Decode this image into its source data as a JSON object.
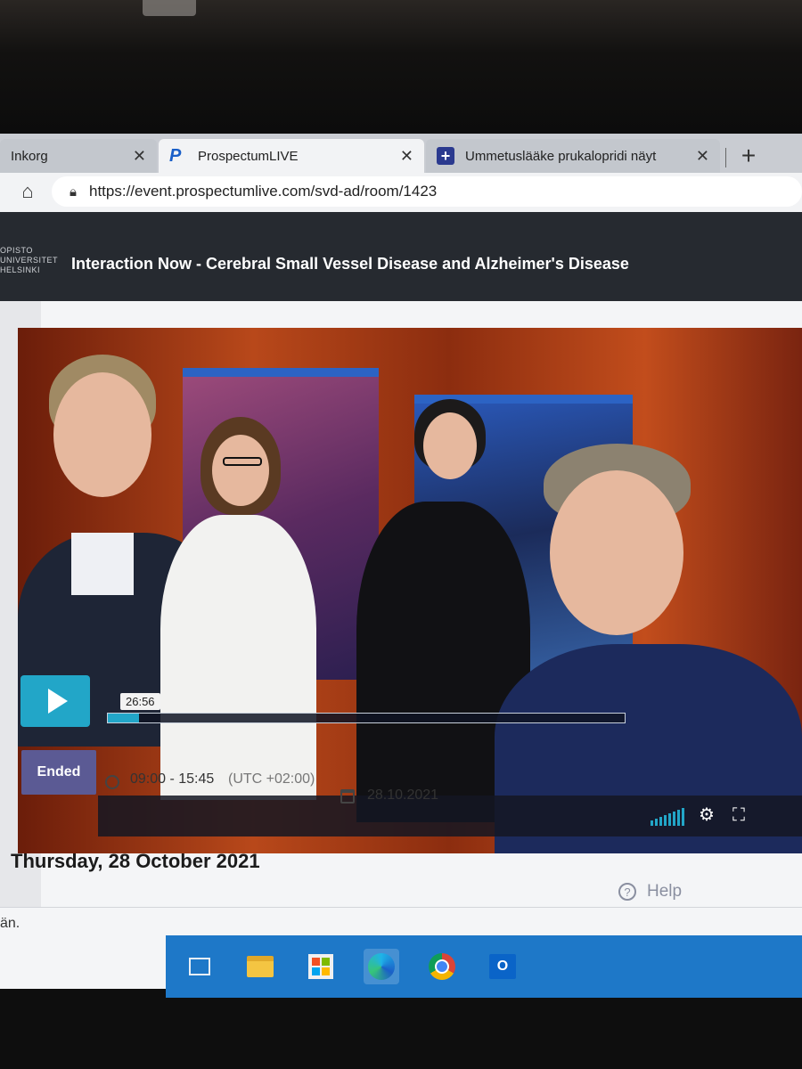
{
  "browser": {
    "tabs": [
      {
        "label": "Inkorg"
      },
      {
        "label": "ProspectumLIVE"
      },
      {
        "label": "Ummetuslääke prukalopridi näyt"
      }
    ],
    "close_glyph": "✕",
    "new_tab_glyph": "+",
    "url": "https://event.prospectumlive.com/svd-ad/room/1423"
  },
  "header": {
    "logo_lines": [
      "OPISTO",
      "UNIVERSITET",
      "HELSINKI"
    ],
    "title": "Interaction Now - Cerebral Small Vessel Disease and Alzheimer's Disease"
  },
  "player": {
    "time_tooltip": "26:56",
    "progress_fraction": 0.06,
    "state_icon": "play-icon"
  },
  "event": {
    "status_badge": "Ended",
    "time_range": "09:00 - 15:45",
    "timezone": "(UTC +02:00)",
    "date": "28.10.2021",
    "day_heading": "Thursday, 28 October 2021",
    "help_label": "Help",
    "help_glyph": "?",
    "footer_fragment": "än."
  },
  "taskbar": {
    "icons": [
      "task-view-icon",
      "file-explorer-icon",
      "store-icon",
      "edge-icon",
      "chrome-icon",
      "outlook-icon"
    ],
    "active": "edge-icon",
    "outlook_letter": "O"
  },
  "colors": {
    "accent": "#22a6c8",
    "header_bg": "#262a30",
    "ended_badge": "#5b5a94",
    "taskbar": "#1e78c8"
  }
}
